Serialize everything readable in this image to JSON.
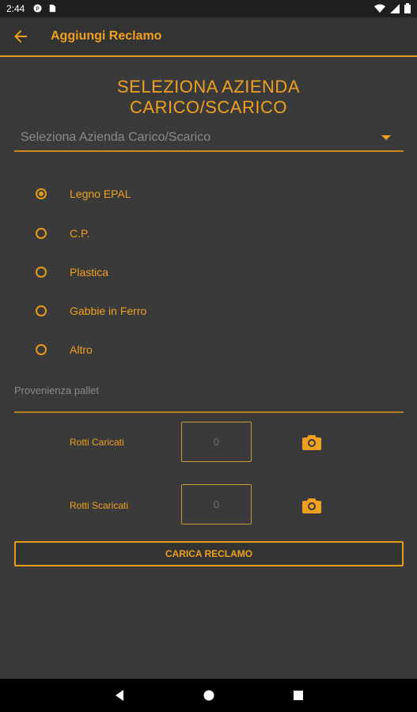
{
  "statusbar": {
    "time": "2:44"
  },
  "appbar": {
    "title": "Aggiungi Reclamo"
  },
  "header": {
    "line1": "SELEZIONA AZIENDA",
    "line2": "CARICO/SCARICO"
  },
  "dropdown": {
    "placeholder": "Seleziona Azienda Carico/Scarico"
  },
  "pallet_types": [
    {
      "label": "Legno EPAL",
      "selected": true
    },
    {
      "label": "C.P.",
      "selected": false
    },
    {
      "label": "Plastica",
      "selected": false
    },
    {
      "label": "Gabbie in Ferro",
      "selected": false
    },
    {
      "label": "Altro",
      "selected": false
    }
  ],
  "provenienza": {
    "placeholder": "Provenienza pallet"
  },
  "rotti_caricati": {
    "label": "Rotti Caricati",
    "value": "0"
  },
  "rotti_scaricati": {
    "label": "Rotti Scaricati",
    "value": "0"
  },
  "submit": {
    "label": "CARICA RECLAMO"
  },
  "colors": {
    "accent": "#f0a020",
    "background": "#3a3a3a",
    "appbar": "#333333"
  }
}
